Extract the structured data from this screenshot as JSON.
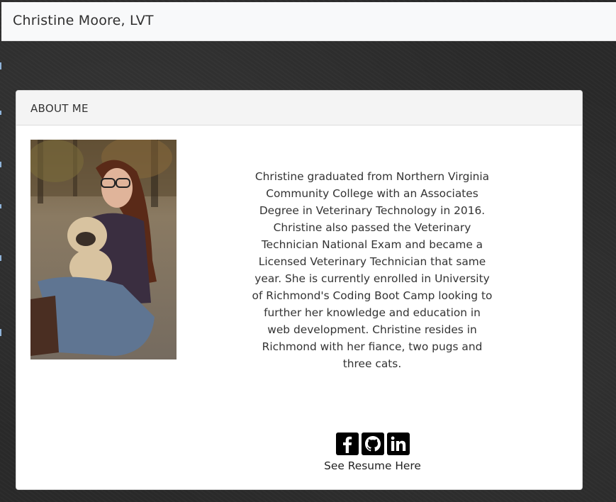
{
  "navbar": {
    "brand": "Christine Moore, LVT"
  },
  "about": {
    "header": "ABOUT ME",
    "photo_alt": "Christine sitting with a pug",
    "bio": "Christine graduated from Northern Virginia Community College with an Associates Degree in Veterinary Technology in 2016. Christine also passed the Veterinary Technician National Exam and became a Licensed Veterinary Technician that same year. She is currently enrolled in University of Richmond's Coding Boot Camp looking to further her knowledge and education in web development. Christine resides in Richmond with her fiance, two pugs and three cats.",
    "socials": [
      {
        "icon": "facebook-icon"
      },
      {
        "icon": "github-icon"
      },
      {
        "icon": "linkedin-icon"
      }
    ],
    "resume_link": "See Resume Here"
  },
  "colors": {
    "navbar_bg": "#f8f9fa",
    "card_header_bg": "#f4f4f4",
    "page_bg": "#2a2a2a"
  }
}
